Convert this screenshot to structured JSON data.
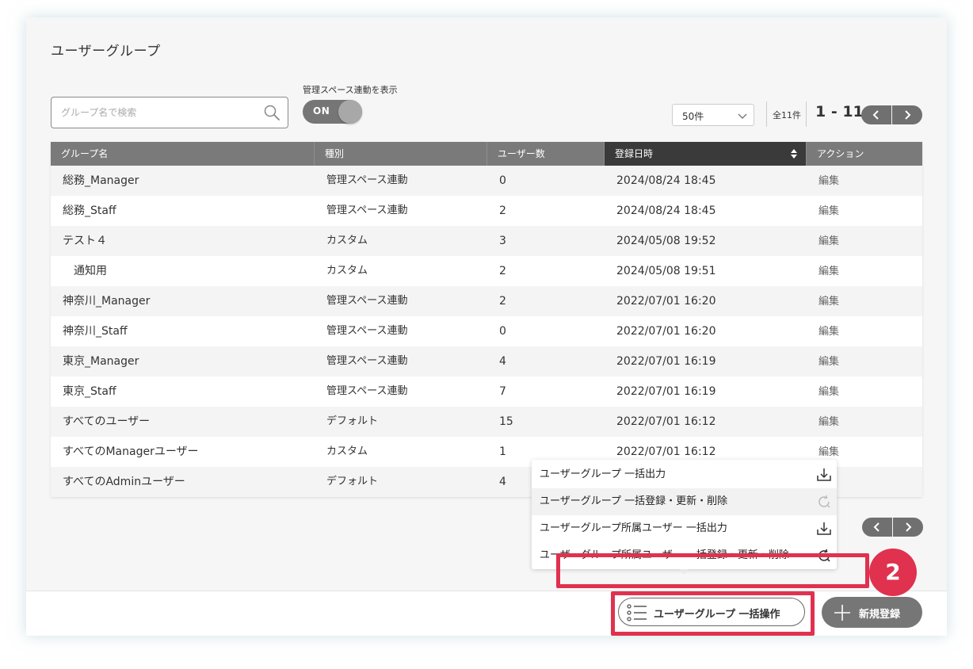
{
  "page": {
    "title": "ユーザーグループ"
  },
  "search": {
    "placeholder": "グループ名で検索"
  },
  "toggle": {
    "label": "管理スペース連動を表示",
    "state_text": "ON",
    "on": true
  },
  "pagination": {
    "per_page": "50件",
    "total": "全11件",
    "range": "1 - 11",
    "prev_icon": "chevron-left-icon",
    "next_icon": "chevron-right-icon"
  },
  "table": {
    "columns": [
      "グループ名",
      "種別",
      "ユーザー数",
      "登録日時",
      "アクション"
    ],
    "sorted_column": "登録日時",
    "rows": [
      {
        "name": "総務_Manager",
        "type": "管理スペース連動",
        "users": "0",
        "registered": "2024/08/24 18:45",
        "action": "編集"
      },
      {
        "name": "総務_Staff",
        "type": "管理スペース連動",
        "users": "2",
        "registered": "2024/08/24 18:45",
        "action": "編集"
      },
      {
        "name": "テスト４",
        "type": "カスタム",
        "users": "3",
        "registered": "2024/05/08 19:52",
        "action": "編集"
      },
      {
        "name": "通知用",
        "type": "カスタム",
        "users": "2",
        "registered": "2024/05/08 19:51",
        "action": "編集"
      },
      {
        "name": "神奈川_Manager",
        "type": "管理スペース連動",
        "users": "2",
        "registered": "2022/07/01 16:20",
        "action": "編集"
      },
      {
        "name": "神奈川_Staff",
        "type": "管理スペース連動",
        "users": "0",
        "registered": "2022/07/01 16:20",
        "action": "編集"
      },
      {
        "name": "東京_Manager",
        "type": "管理スペース連動",
        "users": "4",
        "registered": "2022/07/01 16:19",
        "action": "編集"
      },
      {
        "name": "東京_Staff",
        "type": "管理スペース連動",
        "users": "7",
        "registered": "2022/07/01 16:19",
        "action": "編集"
      },
      {
        "name": "すべてのユーザー",
        "type": "デフォルト",
        "users": "15",
        "registered": "2022/07/01 16:12",
        "action": "編集"
      },
      {
        "name": "すべてのManagerユーザー",
        "type": "カスタム",
        "users": "1",
        "registered": "2022/07/01 16:12",
        "action": "編集"
      },
      {
        "name": "すべてのAdminユーザー",
        "type": "デフォルト",
        "users": "4",
        "registered": "",
        "action": ""
      }
    ]
  },
  "bulk_menu": {
    "items": [
      {
        "label": "ユーザーグループ 一括出力",
        "icon": "download-icon"
      },
      {
        "label": "ユーザーグループ 一括登録・更新・削除",
        "icon": "refresh-icon"
      },
      {
        "label": "ユーザーグループ所属ユーザー 一括出力",
        "icon": "download-icon"
      },
      {
        "label": "ユーザーグループ所属ユーザー 一括登録・更新・削除",
        "icon": "refresh-icon"
      }
    ]
  },
  "annotation": {
    "step": "2"
  },
  "footer": {
    "bulk_button_label": "ユーザーグループ 一括操作",
    "bulk_button_icon": "list-icon",
    "new_button_label": "新規登録",
    "new_button_icon": "plus-icon"
  },
  "colors": {
    "highlight": "#e0314f",
    "header_bg": "#7a7a7a",
    "header_active_bg": "#3a3a3a",
    "button_gray": "#767676"
  }
}
